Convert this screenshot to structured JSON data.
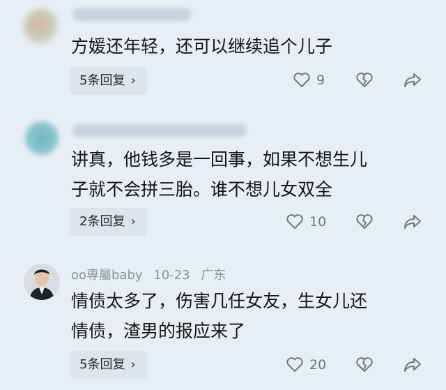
{
  "comments": [
    {
      "text": "方媛还年轻，还可以继续追个儿子",
      "reply_label": "5条回复",
      "like_count": "9"
    },
    {
      "text_line1": "讲真，他钱多是一回事，如果不想生儿",
      "text_line2": "子就不会拼三胎。谁不想儿女双全",
      "reply_label": "2条回复",
      "like_count": "10"
    },
    {
      "username": "oo専屬baby",
      "date": "10-23",
      "location": "广东",
      "text_line1": "情债太多了，伤害几任女友，生女儿还",
      "text_line2": "情债，渣男的报应来了",
      "reply_label": "5条回复",
      "like_count": "20"
    }
  ],
  "icons": {
    "like": "heart-outline-icon",
    "dislike": "broken-heart-icon",
    "share": "share-arrow-icon",
    "chevron": "chevron-right-icon"
  },
  "colors": {
    "background": "#e8eef6",
    "button": "#dde4ec",
    "icon": "#6f7884"
  }
}
